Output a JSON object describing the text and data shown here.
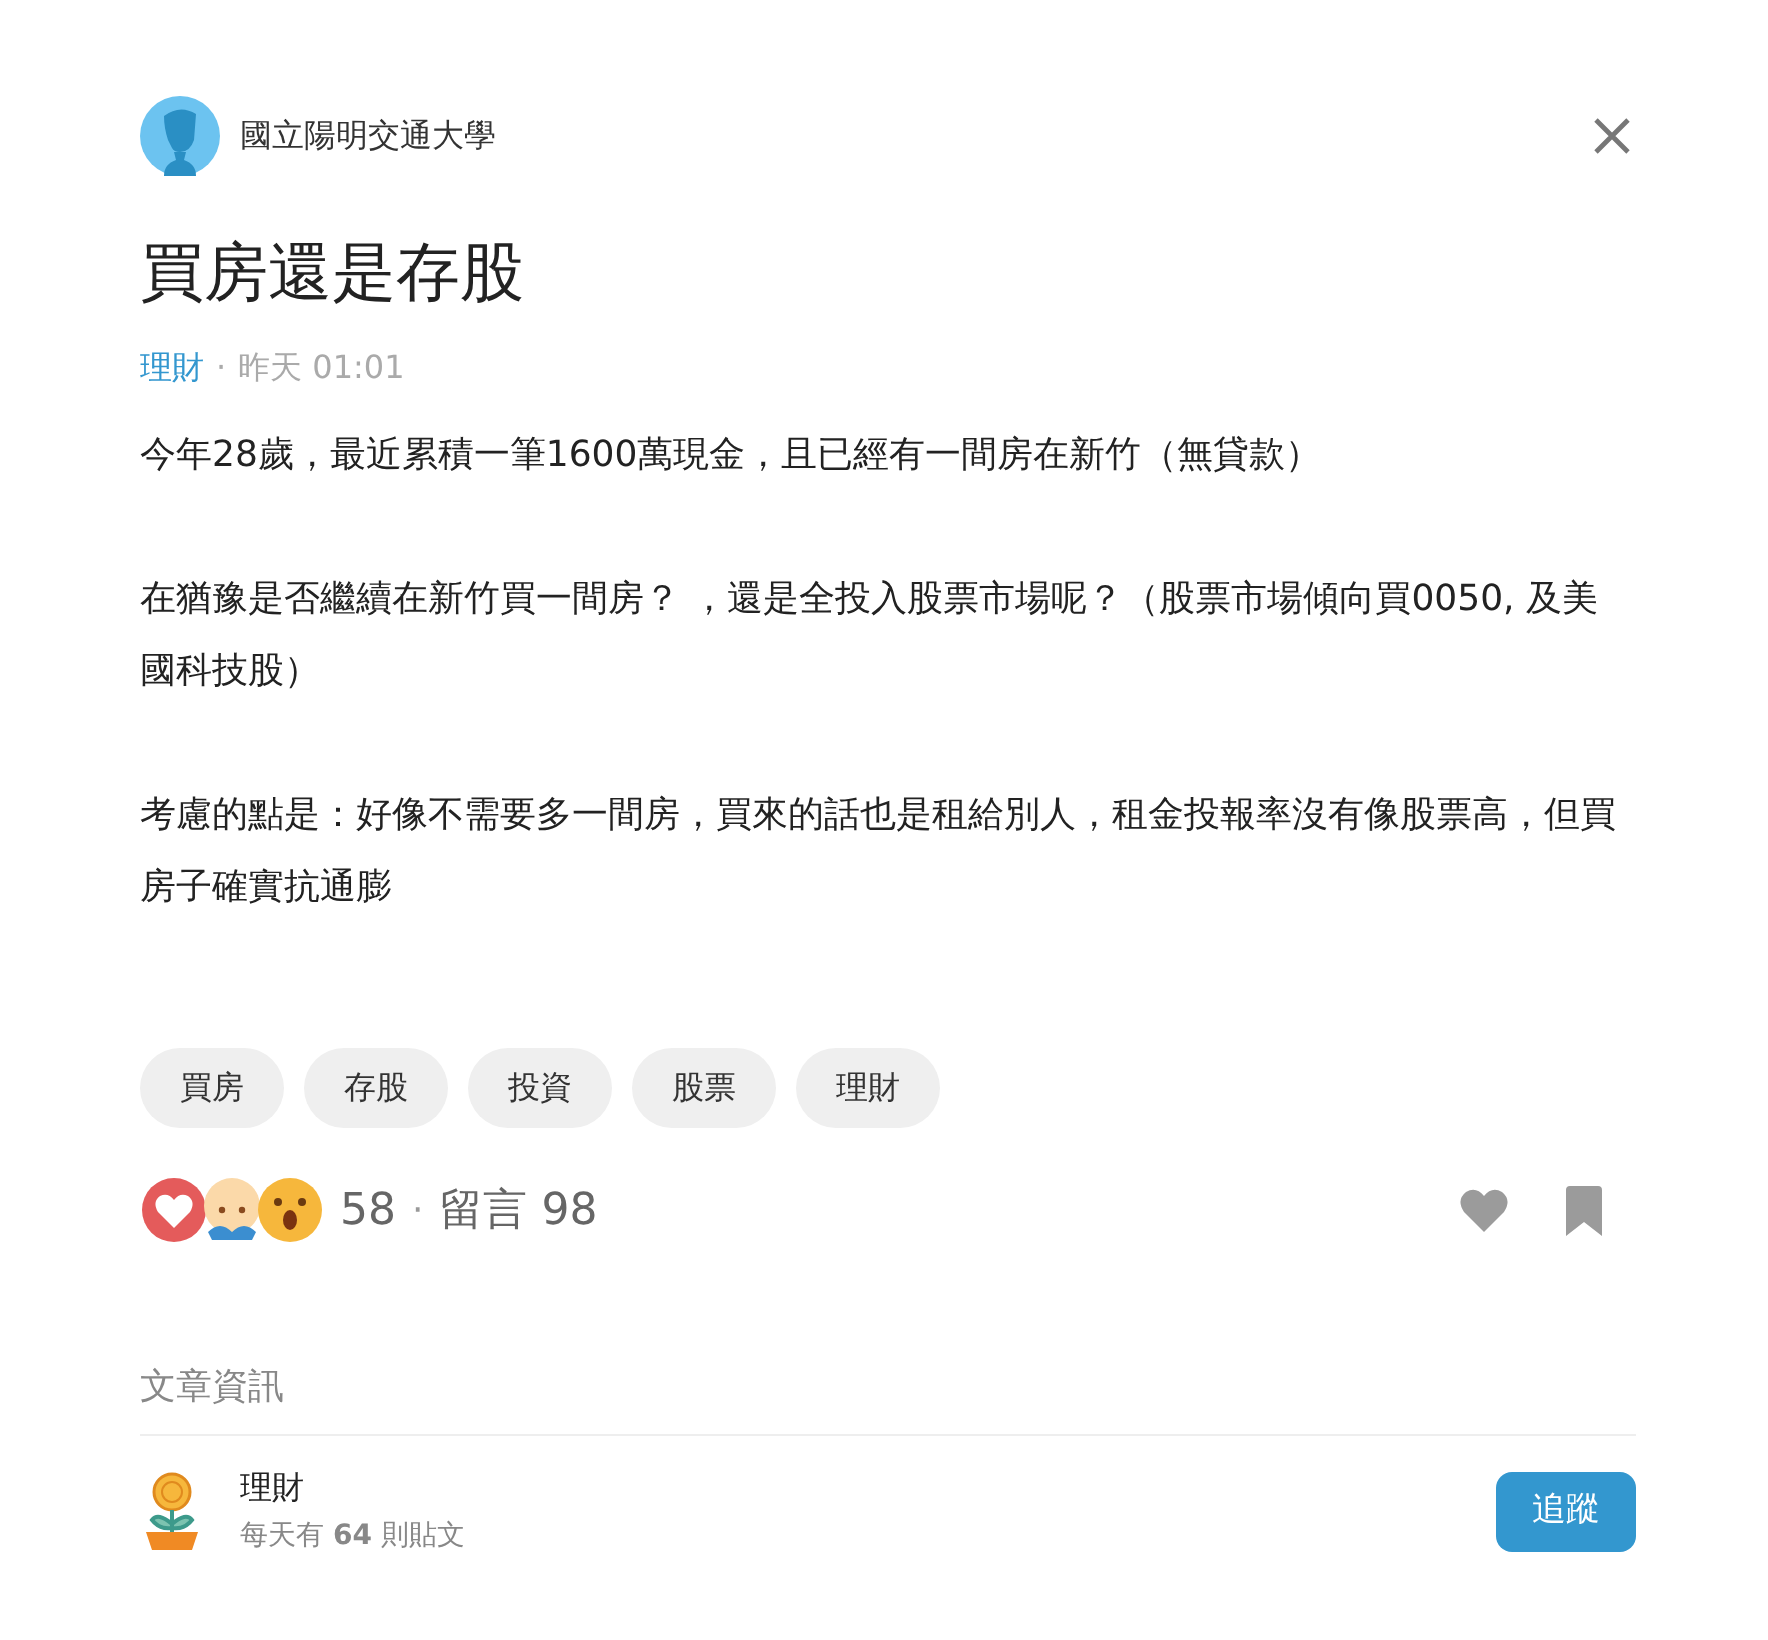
{
  "author": {
    "name": "國立陽明交通大學"
  },
  "title": "買房還是存股",
  "meta": {
    "board": "理財",
    "separator": "·",
    "time": "昨天 01:01"
  },
  "body": [
    "今年28歲，最近累積一筆1600萬現金，且已經有一間房在新竹（無貸款）",
    "在猶豫是否繼續在新竹買一間房？ ，還是全投入股票市場呢？（股票市場傾向買0050, 及美國科技股）",
    "考慮的點是：好像不需要多一間房，買來的話也是租給別人，租金投報率沒有像股票高，但買房子確實抗通膨"
  ],
  "tags": [
    "買房",
    "存股",
    "投資",
    "股票",
    "理財"
  ],
  "reactions": {
    "count": "58",
    "separator": "·",
    "comments": "留言 98",
    "liked": false,
    "saved": false
  },
  "info": {
    "heading": "文章資訊",
    "board": "理財",
    "stats": "每天有 **64** 則貼文",
    "follow_button": "追蹤"
  }
}
